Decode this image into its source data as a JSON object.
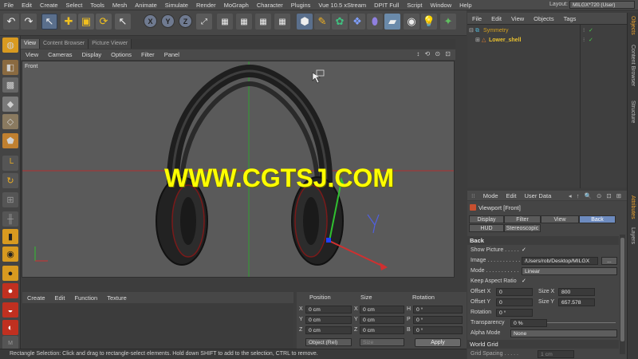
{
  "menubar": {
    "items": [
      "File",
      "Edit",
      "Create",
      "Select",
      "Tools",
      "Mesh",
      "Animate",
      "Simulate",
      "Render",
      "MoGraph",
      "Character",
      "Plugins",
      "Vue 10.5 xStream",
      "DPIT Full",
      "Script",
      "Window",
      "Help"
    ],
    "layout_label": "Layout:",
    "layout_value": "MILGX*720 (User)"
  },
  "toolbar": {
    "axis_x": "X",
    "axis_y": "Y",
    "axis_z": "Z"
  },
  "viewport": {
    "tabs": [
      "View",
      "Content Browser",
      "Picture Viewer"
    ],
    "menu": [
      "View",
      "Cameras",
      "Display",
      "Options",
      "Filter",
      "Panel"
    ],
    "nav_icons": "↕ ⟲ ⊙ ⊡",
    "label": "Front",
    "watermark": "WWW.CGTSJ.COM",
    "colors": {
      "bg": "#5a5a5a",
      "x_axis": "#c03030",
      "y_axis": "#30b030",
      "watermark": "#ffff00"
    }
  },
  "timeline": {
    "menu": [
      "Create",
      "Edit",
      "Function",
      "Texture"
    ]
  },
  "coords": {
    "headers": [
      "Position",
      "Size",
      "Rotation"
    ],
    "rows": [
      {
        "axis": "X",
        "pos": "0 cm",
        "size_axis": "X",
        "size": "0 cm",
        "rot_axis": "H",
        "rot": "0 °"
      },
      {
        "axis": "Y",
        "pos": "0 cm",
        "size_axis": "Y",
        "size": "0 cm",
        "rot_axis": "P",
        "rot": "0 °"
      },
      {
        "axis": "Z",
        "pos": "0 cm",
        "size_axis": "Z",
        "size": "0 cm",
        "rot_axis": "B",
        "rot": "0 °"
      }
    ],
    "mode": "Object (Rel)",
    "size_mode": "Size",
    "apply": "Apply"
  },
  "statusbar": {
    "text": "Rectangle Selection: Click and drag to rectangle-select elements. Hold down SHIFT to add to the selection, CTRL to remove."
  },
  "objects": {
    "menu": [
      "File",
      "Edit",
      "View",
      "Objects",
      "Tags"
    ],
    "items": [
      {
        "name": "Symmetry",
        "color": "#d4a020"
      },
      {
        "name": "Lower_shell",
        "color": "#e8c030"
      }
    ]
  },
  "side_tabs": {
    "top": [
      "Objects",
      "Content Browser",
      "Structure"
    ],
    "bottom": [
      "Attributes",
      "Layers"
    ]
  },
  "attributes": {
    "menu": [
      "Mode",
      "Edit",
      "User Data"
    ],
    "title": "Viewport [Front]",
    "tabs_row1": [
      "Display",
      "Filter",
      "View",
      "Back"
    ],
    "tabs_row2": [
      "HUD",
      "Stereoscopic"
    ],
    "section": "Back",
    "show_picture_label": "Show Picture . . . . .",
    "show_picture": "✓",
    "image_label": "Image . . . . . . . . . . .",
    "image_value": "/Users/rob/Desktop/MILGX",
    "image_button": "...",
    "mode_label": "Mode . . . . . . . . . . .",
    "mode_value": "Linear",
    "keep_aspect_label": "Keep Aspect Ratio",
    "keep_aspect": "✓",
    "offset_x_label": "Offset X",
    "offset_x": "0",
    "size_x_label": "Size X",
    "size_x": "800",
    "offset_y_label": "Offset Y",
    "offset_y": "0",
    "size_y_label": "Size Y",
    "size_y": "657.578",
    "rotation_label": "Rotation",
    "rotation": "0 °",
    "transparency_label": "Transparency",
    "transparency": "0 %",
    "alpha_mode_label": "Alpha Mode",
    "alpha_mode": "None",
    "world_grid_section": "World Grid",
    "grid_spacing_label": "Grid Spacing . . . . .",
    "grid_spacing": "1 cm"
  }
}
